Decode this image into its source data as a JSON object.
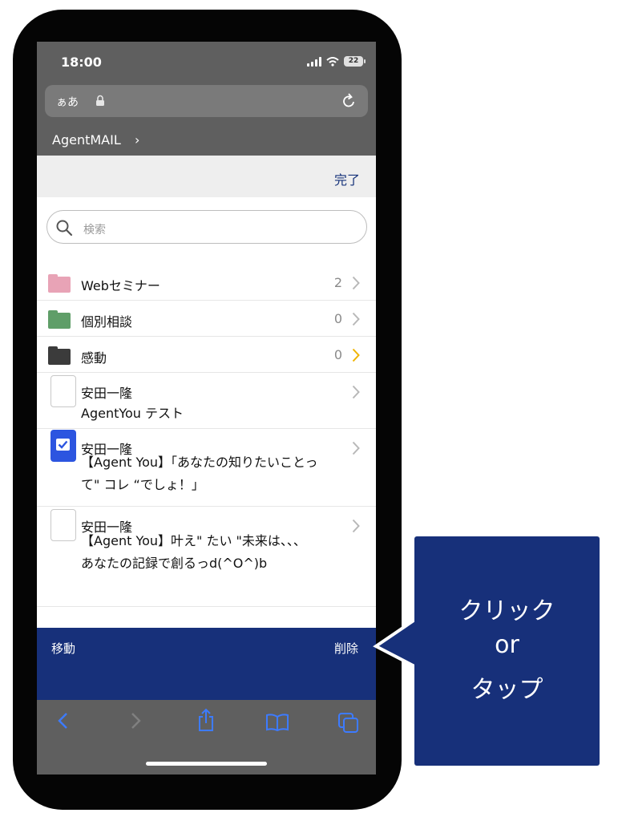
{
  "status_bar": {
    "time": "18:00",
    "battery": "22"
  },
  "address_bar": {
    "aa": "ぁあ"
  },
  "site": {
    "name": "AgentMAIL",
    "chevron": "›"
  },
  "top_bar": {
    "done_label": "完了"
  },
  "search": {
    "placeholder": "検索"
  },
  "folders": [
    {
      "label": "Webセミナー",
      "count": "2",
      "color": "#e8a3b6"
    },
    {
      "label": "個別相談",
      "count": "0",
      "color": "#5f9e68"
    },
    {
      "label": "感動",
      "count": "0",
      "color": "#3b3b3b"
    }
  ],
  "messages": [
    {
      "sender": "安田一隆",
      "subject": "AgentYou テスト",
      "checked": false
    },
    {
      "sender": "安田一隆",
      "subject": "【Agent You】「あなたの知りたいことって\" コレ “でしょ！」",
      "checked": true
    },
    {
      "sender": "安田一隆",
      "subject": "【Agent You】叶え\" たい \"未来は、、、 あなたの記録で創るっd(^O^)b",
      "checked": false
    }
  ],
  "action_bar": {
    "move_label": "移動",
    "delete_label": "削除"
  },
  "callout": {
    "line1": "クリック",
    "line2": "or",
    "line3": "タップ"
  },
  "colors": {
    "accent_navy": "#17307a",
    "checkbox_blue": "#2c55e0",
    "chevron_highlight": "#f0b400"
  }
}
